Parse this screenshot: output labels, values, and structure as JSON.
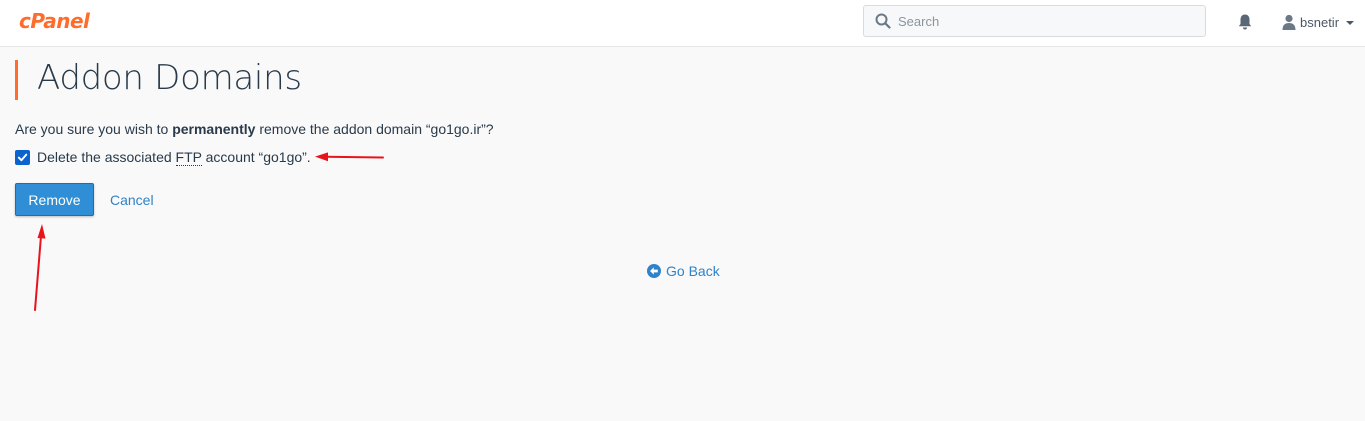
{
  "header": {
    "logo_text": "cPanel",
    "search_placeholder": "Search",
    "username": "bsnetir",
    "icons": {
      "search": "search-icon",
      "notifications": "bell-icon",
      "user": "user-icon",
      "menu_caret": "caret-down-icon"
    }
  },
  "page": {
    "title": "Addon Domains",
    "question_prefix": "Are you sure you wish to ",
    "question_bold": "permanently",
    "question_suffix": " remove the addon domain “go1go.ir”?",
    "checkbox_checked": true,
    "checkbox_label_prefix": "Delete the associated ",
    "checkbox_label_abbr": "FTP",
    "checkbox_label_suffix": " account “go1go”.",
    "remove_label": "Remove",
    "cancel_label": "Cancel",
    "go_back_label": "Go Back"
  },
  "colors": {
    "brand_orange": "#ff6c2c",
    "primary_button": "#2f8ed5",
    "link": "#2f83c8",
    "annotation_arrow": "#e8141c"
  }
}
